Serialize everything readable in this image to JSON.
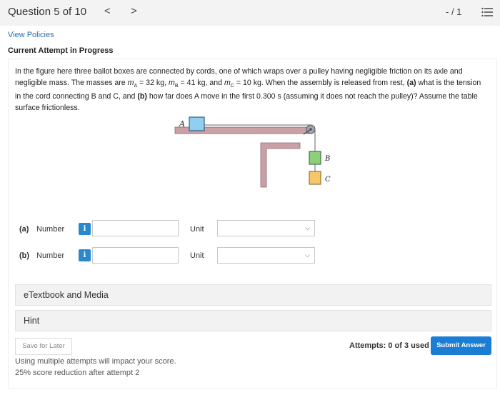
{
  "header": {
    "question_counter": "Question 5 of 10",
    "prev_glyph": "<",
    "next_glyph": ">",
    "score": "- / 1",
    "menu_icon": "list-icon"
  },
  "links": {
    "view_policies": "View Policies"
  },
  "attempt_status": "Current Attempt in Progress",
  "question": {
    "text_parts": {
      "p1": "In the figure here three ballot boxes are connected by cords, one of which wraps over a pulley having negligible friction on its axle and negligible mass. The masses are ",
      "ma": "m",
      "ma_sub": "A",
      "ma_val": " = 32 kg, ",
      "mb": "m",
      "mb_sub": "B",
      "mb_val": " = 41 kg, and ",
      "mc": "m",
      "mc_sub": "C",
      "mc_val": " = 10 kg. When the assembly is released from rest, ",
      "a_label": "(a)",
      "p2": " what is the tension in the cord connecting B and C, and ",
      "b_label": "(b)",
      "p3": " how far does A move in the first 0.300 s (assuming it does not reach the pulley)? Assume the table surface frictionless."
    },
    "figure_labels": {
      "A": "A",
      "B": "B",
      "C": "C"
    }
  },
  "answers": [
    {
      "part": "(a)",
      "number_label": "Number",
      "info": "i",
      "value": "",
      "unit_label": "Unit",
      "unit_value": ""
    },
    {
      "part": "(b)",
      "number_label": "Number",
      "info": "i",
      "value": "",
      "unit_label": "Unit",
      "unit_value": ""
    }
  ],
  "panels": {
    "etextbook": "eTextbook and Media",
    "hint": "Hint"
  },
  "footer": {
    "save_later": "Save for Later",
    "attempts": "Attempts: 0 of 3 used",
    "submit": "Submit Answer",
    "note1": "Using multiple attempts will impact your score.",
    "note2": "25% score reduction after attempt 2"
  },
  "colors": {
    "accent": "#1a7fd4",
    "info_button": "#2a88cf",
    "link": "#2a6db5",
    "table": "#c9a0a6",
    "box_a": "#8fd0f0",
    "box_b": "#8dcf7a",
    "box_c": "#f5c76a"
  }
}
